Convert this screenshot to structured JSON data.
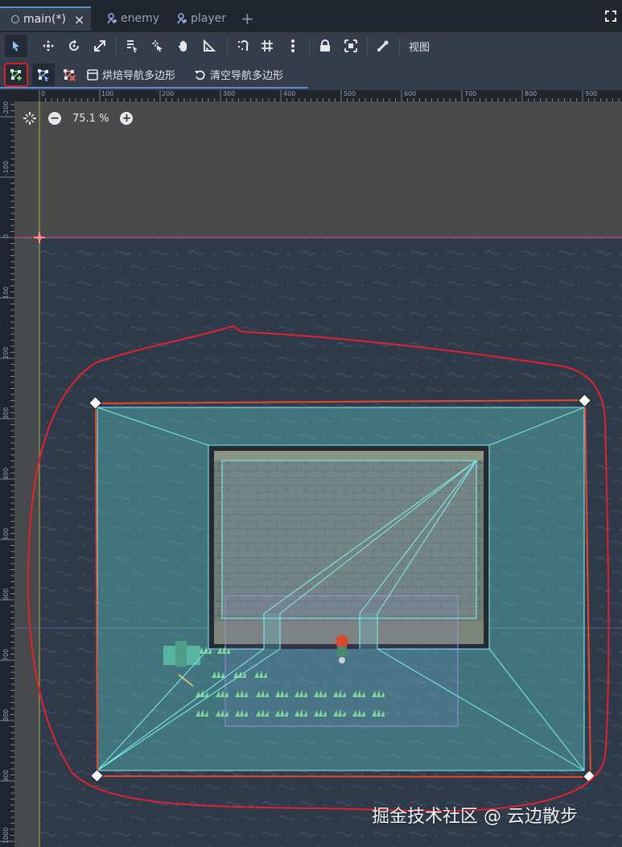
{
  "tabs": [
    {
      "label": "main(*)",
      "active": true
    },
    {
      "label": "enemy",
      "active": false
    },
    {
      "label": "player",
      "active": false
    }
  ],
  "tabbar": {
    "add_tab": "+",
    "close": "×"
  },
  "toolbar1": {
    "icons": [
      "select-tool-icon",
      "move-tool-icon",
      "rotate-tool-icon",
      "scale-tool-icon",
      "list-select-icon",
      "pivot-icon",
      "pan-tool-icon",
      "ruler-tool-icon",
      "smart-snap-icon",
      "grid-snap-icon",
      "more-options-icon",
      "lock-icon",
      "group-icon",
      "skeleton-icon"
    ],
    "view_menu": "视图"
  },
  "toolbar2": {
    "bake_navpoly": "烘焙导航多边形",
    "clear_navpoly": "清空导航多边形"
  },
  "ruler": {
    "top_labels": [
      "0",
      "100",
      "200",
      "300",
      "400",
      "500",
      "600",
      "700",
      "800",
      "900"
    ],
    "left_labels": [
      "-200",
      "-100",
      "0",
      "100",
      "200",
      "300",
      "400",
      "500",
      "600",
      "700",
      "800",
      "900",
      "1000"
    ]
  },
  "zoom": {
    "value": "75.1 %",
    "minus": "−",
    "plus": "+"
  },
  "watermark": "掘金技术社区 @ 云边散步",
  "colors": {
    "accent": "#5b8dd6",
    "highlight_red": "#d8222a",
    "navpoly_outline": "#e34a2b",
    "navpoly_fill": "#5fd2d2",
    "water": "#2f3a4a"
  }
}
